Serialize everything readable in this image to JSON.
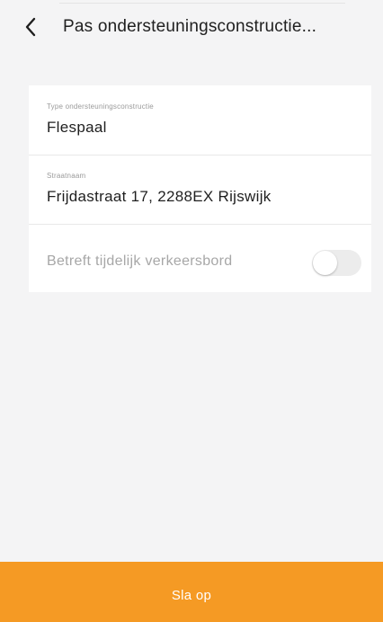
{
  "header": {
    "title": "Pas ondersteuningsconstructie..."
  },
  "form": {
    "support_type": {
      "label": "Type ondersteuningsconstructie",
      "value": "Flespaal"
    },
    "street": {
      "label": "Straatnaam",
      "value": "Frijdastraat 17, 2288EX Rijswijk"
    },
    "temporary_sign": {
      "label": "Betreft tijdelijk verkeersbord",
      "enabled": false
    }
  },
  "footer": {
    "save_label": "Sla op"
  },
  "colors": {
    "accent": "#f59a24",
    "background": "#f4f4f5"
  }
}
